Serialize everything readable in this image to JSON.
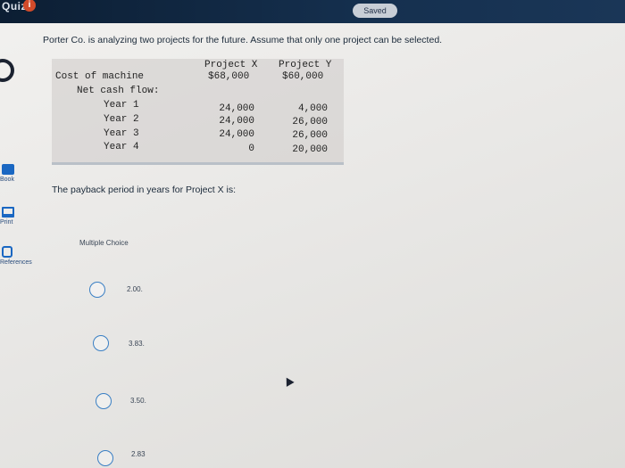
{
  "header": {
    "quiz_label": "Quiz",
    "info_badge": "i",
    "saved": "Saved"
  },
  "sidebar": {
    "tools": [
      {
        "label": "Book"
      },
      {
        "label": "Print"
      },
      {
        "label": "References"
      }
    ]
  },
  "question": {
    "text": "Porter Co. is analyzing two projects for the future. Assume that only one project can be selected.",
    "prompt": "The payback period in years for Project X is:",
    "table": {
      "col_x": "Project X",
      "col_y": "Project Y",
      "rows": [
        {
          "label": "Cost of machine",
          "x": "$68,000",
          "y": "$60,000"
        },
        {
          "label": "Net cash flow:",
          "x": "",
          "y": ""
        },
        {
          "label": "Year 1",
          "x": "24,000",
          "y": "4,000"
        },
        {
          "label": "Year 2",
          "x": "24,000",
          "y": "26,000"
        },
        {
          "label": "Year 3",
          "x": "24,000",
          "y": "26,000"
        },
        {
          "label": "Year 4",
          "x": "0",
          "y": "20,000"
        }
      ]
    }
  },
  "choices": {
    "label": "Multiple Choice",
    "options": [
      {
        "text": "2.00."
      },
      {
        "text": "3.83."
      },
      {
        "text": "3.50."
      },
      {
        "text": "2.83"
      }
    ]
  }
}
